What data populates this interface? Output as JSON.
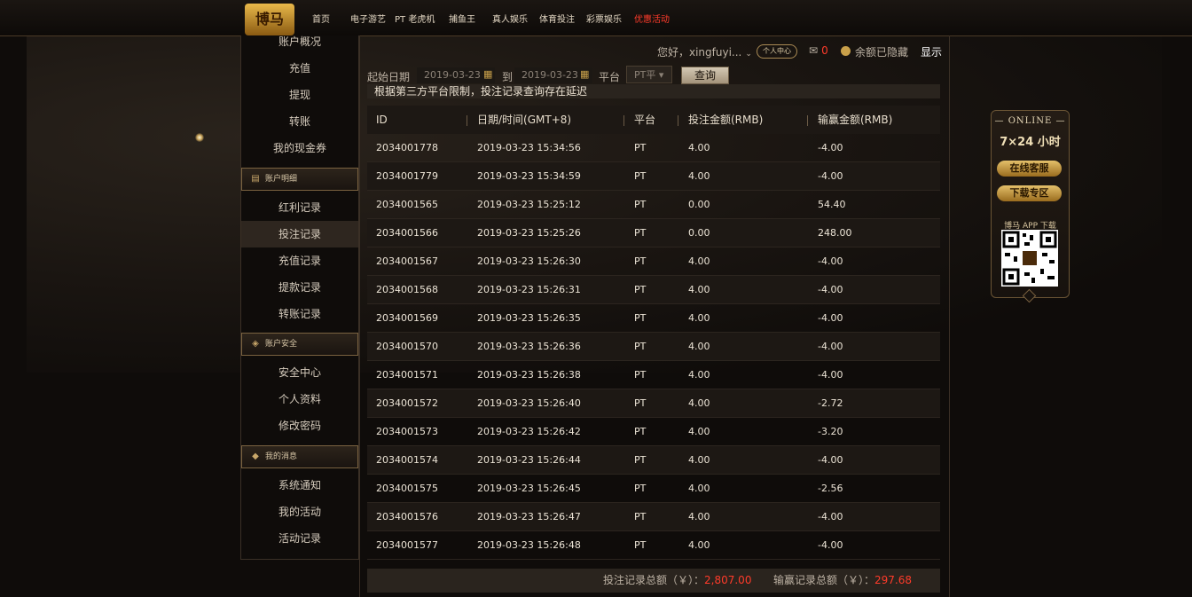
{
  "logo": {
    "text": "博马"
  },
  "nav": [
    {
      "label": "首页",
      "hot": false
    },
    {
      "label": "电子游艺",
      "hot": false
    },
    {
      "label": "PT 老虎机",
      "hot": false
    },
    {
      "label": "捕鱼王",
      "hot": false
    },
    {
      "label": "真人娱乐",
      "hot": false
    },
    {
      "label": "体育投注",
      "hot": false
    },
    {
      "label": "彩票娱乐",
      "hot": false
    },
    {
      "label": "优惠活动",
      "hot": true
    }
  ],
  "sidebar": {
    "top_items": [
      "账户概况",
      "充值",
      "提现",
      "转账",
      "我的现金券"
    ],
    "section1": {
      "title": "账户明细",
      "items": [
        "红利记录",
        "投注记录",
        "充值记录",
        "提款记录",
        "转账记录"
      ]
    },
    "section2": {
      "title": "账户安全",
      "items": [
        "安全中心",
        "个人资料",
        "修改密码"
      ]
    },
    "section3": {
      "title": "我的消息",
      "items": [
        "系统通知",
        "我的活动",
        "活动记录"
      ]
    },
    "active": "投注记录"
  },
  "userbar": {
    "greeting": "您好，xingfuyi...",
    "center_btn": "个人中心",
    "mail_count": "0",
    "balance_status": "余额已隐藏",
    "show_btn": "显示"
  },
  "filters": {
    "start_label": "起始日期",
    "start_date": "2019-03-23",
    "to_label": "到",
    "end_date": "2019-03-23",
    "platform_label": "平台",
    "platform_value": "PT平",
    "query_btn": "查询"
  },
  "notice": "根据第三方平台限制，投注记录查询存在延迟",
  "table": {
    "headers": [
      "ID",
      "日期/时间(GMT+8)",
      "平台",
      "投注金额(RMB)",
      "输赢金额(RMB)"
    ],
    "rows": [
      [
        "2034001778",
        "2019-03-23 15:34:56",
        "PT",
        "4.00",
        "-4.00"
      ],
      [
        "2034001779",
        "2019-03-23 15:34:59",
        "PT",
        "4.00",
        "-4.00"
      ],
      [
        "2034001565",
        "2019-03-23 15:25:12",
        "PT",
        "0.00",
        "54.40"
      ],
      [
        "2034001566",
        "2019-03-23 15:25:26",
        "PT",
        "0.00",
        "248.00"
      ],
      [
        "2034001567",
        "2019-03-23 15:26:30",
        "PT",
        "4.00",
        "-4.00"
      ],
      [
        "2034001568",
        "2019-03-23 15:26:31",
        "PT",
        "4.00",
        "-4.00"
      ],
      [
        "2034001569",
        "2019-03-23 15:26:35",
        "PT",
        "4.00",
        "-4.00"
      ],
      [
        "2034001570",
        "2019-03-23 15:26:36",
        "PT",
        "4.00",
        "-4.00"
      ],
      [
        "2034001571",
        "2019-03-23 15:26:38",
        "PT",
        "4.00",
        "-4.00"
      ],
      [
        "2034001572",
        "2019-03-23 15:26:40",
        "PT",
        "4.00",
        "-2.72"
      ],
      [
        "2034001573",
        "2019-03-23 15:26:42",
        "PT",
        "4.00",
        "-3.20"
      ],
      [
        "2034001574",
        "2019-03-23 15:26:44",
        "PT",
        "4.00",
        "-4.00"
      ],
      [
        "2034001575",
        "2019-03-23 15:26:45",
        "PT",
        "4.00",
        "-2.56"
      ],
      [
        "2034001576",
        "2019-03-23 15:26:47",
        "PT",
        "4.00",
        "-4.00"
      ],
      [
        "2034001577",
        "2019-03-23 15:26:48",
        "PT",
        "4.00",
        "-4.00"
      ]
    ]
  },
  "summary": {
    "bet_label": "投注记录总额（￥）：",
    "bet_value": "2,807.00",
    "win_label": "输赢记录总额（￥）：",
    "win_value": "297.68"
  },
  "widget": {
    "online": "ONLINE",
    "hours": "7×24 小时",
    "service_btn": "在线客服",
    "download_btn": "下载专区",
    "app_label": "博马 APP 下载"
  },
  "colors": {
    "accent_red": "#ff3b2a",
    "gold": "#c9a04a"
  }
}
